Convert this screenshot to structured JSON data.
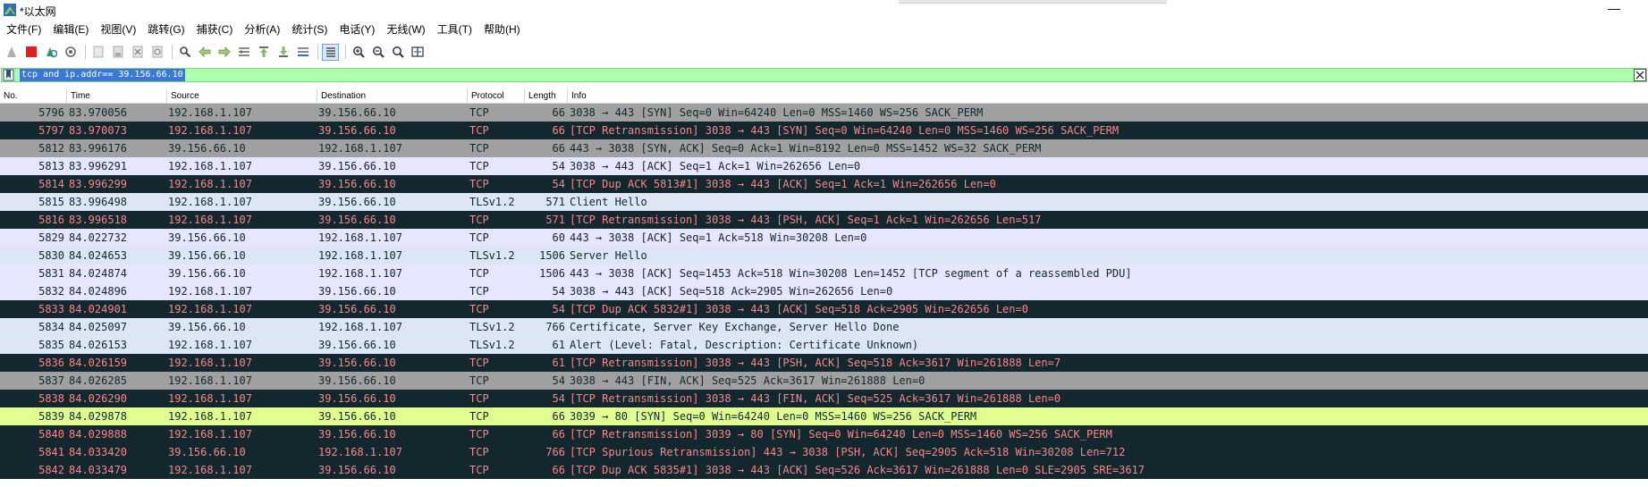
{
  "window": {
    "title": "*以太网"
  },
  "menu": [
    "文件(F)",
    "编辑(E)",
    "视图(V)",
    "跳转(G)",
    "捕获(C)",
    "分析(A)",
    "统计(S)",
    "电话(Y)",
    "无线(W)",
    "工具(T)",
    "帮助(H)"
  ],
  "filter": {
    "value": "tcp and ip.addr== 39.156.66.10"
  },
  "columns": [
    "No.",
    "Time",
    "Source",
    "Destination",
    "Protocol",
    "Length",
    "Info"
  ],
  "colors": {
    "syn_bg": "#a0a0a0",
    "bad_bg": "#12272e",
    "bad_fg": "#f78787",
    "tcp_bg": "#e7e6ff",
    "ssl_bg": "#dde6f5",
    "filter_bg": "#afffaf",
    "selected_bg": "#e0ff90"
  },
  "packets": [
    {
      "no": "5796",
      "time": "83.970056",
      "src": "192.168.1.107",
      "dst": "39.156.66.10",
      "proto": "TCP",
      "len": "66",
      "info": "3038 → 443 [SYN] Seq=0 Win=64240 Len=0 MSS=1460 WS=256 SACK_PERM",
      "style": "syn"
    },
    {
      "no": "5797",
      "time": "83.970073",
      "src": "192.168.1.107",
      "dst": "39.156.66.10",
      "proto": "TCP",
      "len": "66",
      "info": "[TCP Retransmission] 3038 → 443 [SYN] Seq=0 Win=64240 Len=0 MSS=1460 WS=256 SACK_PERM",
      "style": "bad"
    },
    {
      "no": "5812",
      "time": "83.996176",
      "src": "39.156.66.10",
      "dst": "192.168.1.107",
      "proto": "TCP",
      "len": "66",
      "info": "443 → 3038 [SYN, ACK] Seq=0 Ack=1 Win=8192 Len=0 MSS=1452 WS=32 SACK_PERM",
      "style": "syn"
    },
    {
      "no": "5813",
      "time": "83.996291",
      "src": "192.168.1.107",
      "dst": "39.156.66.10",
      "proto": "TCP",
      "len": "54",
      "info": "3038 → 443 [ACK] Seq=1 Ack=1 Win=262656 Len=0",
      "style": "tcp"
    },
    {
      "no": "5814",
      "time": "83.996299",
      "src": "192.168.1.107",
      "dst": "39.156.66.10",
      "proto": "TCP",
      "len": "54",
      "info": "[TCP Dup ACK 5813#1] 3038 → 443 [ACK] Seq=1 Ack=1 Win=262656 Len=0",
      "style": "bad"
    },
    {
      "no": "5815",
      "time": "83.996498",
      "src": "192.168.1.107",
      "dst": "39.156.66.10",
      "proto": "TLSv1.2",
      "len": "571",
      "info": "Client Hello",
      "style": "ssl"
    },
    {
      "no": "5816",
      "time": "83.996518",
      "src": "192.168.1.107",
      "dst": "39.156.66.10",
      "proto": "TCP",
      "len": "571",
      "info": "[TCP Retransmission] 3038 → 443 [PSH, ACK] Seq=1 Ack=1 Win=262656 Len=517",
      "style": "bad"
    },
    {
      "no": "5829",
      "time": "84.022732",
      "src": "39.156.66.10",
      "dst": "192.168.1.107",
      "proto": "TCP",
      "len": "60",
      "info": "443 → 3038 [ACK] Seq=1 Ack=518 Win=30208 Len=0",
      "style": "tcp"
    },
    {
      "no": "5830",
      "time": "84.024653",
      "src": "39.156.66.10",
      "dst": "192.168.1.107",
      "proto": "TLSv1.2",
      "len": "1506",
      "info": "Server Hello",
      "style": "ssl"
    },
    {
      "no": "5831",
      "time": "84.024874",
      "src": "39.156.66.10",
      "dst": "192.168.1.107",
      "proto": "TCP",
      "len": "1506",
      "info": "443 → 3038 [ACK] Seq=1453 Ack=518 Win=30208 Len=1452 [TCP segment of a reassembled PDU]",
      "style": "tcp"
    },
    {
      "no": "5832",
      "time": "84.024896",
      "src": "192.168.1.107",
      "dst": "39.156.66.10",
      "proto": "TCP",
      "len": "54",
      "info": "3038 → 443 [ACK] Seq=518 Ack=2905 Win=262656 Len=0",
      "style": "tcp"
    },
    {
      "no": "5833",
      "time": "84.024901",
      "src": "192.168.1.107",
      "dst": "39.156.66.10",
      "proto": "TCP",
      "len": "54",
      "info": "[TCP Dup ACK 5832#1] 3038 → 443 [ACK] Seq=518 Ack=2905 Win=262656 Len=0",
      "style": "bad"
    },
    {
      "no": "5834",
      "time": "84.025097",
      "src": "39.156.66.10",
      "dst": "192.168.1.107",
      "proto": "TLSv1.2",
      "len": "766",
      "info": "Certificate, Server Key Exchange, Server Hello Done",
      "style": "ssl"
    },
    {
      "no": "5835",
      "time": "84.026153",
      "src": "192.168.1.107",
      "dst": "39.156.66.10",
      "proto": "TLSv1.2",
      "len": "61",
      "info": "Alert (Level: Fatal, Description: Certificate Unknown)",
      "style": "ssl"
    },
    {
      "no": "5836",
      "time": "84.026159",
      "src": "192.168.1.107",
      "dst": "39.156.66.10",
      "proto": "TCP",
      "len": "61",
      "info": "[TCP Retransmission] 3038 → 443 [PSH, ACK] Seq=518 Ack=3617 Win=261888 Len=7",
      "style": "bad"
    },
    {
      "no": "5837",
      "time": "84.026285",
      "src": "192.168.1.107",
      "dst": "39.156.66.10",
      "proto": "TCP",
      "len": "54",
      "info": "3038 → 443 [FIN, ACK] Seq=525 Ack=3617 Win=261888 Len=0",
      "style": "syn"
    },
    {
      "no": "5838",
      "time": "84.026290",
      "src": "192.168.1.107",
      "dst": "39.156.66.10",
      "proto": "TCP",
      "len": "54",
      "info": "[TCP Retransmission] 3038 → 443 [FIN, ACK] Seq=525 Ack=3617 Win=261888 Len=0",
      "style": "bad"
    },
    {
      "no": "5839",
      "time": "84.029878",
      "src": "192.168.1.107",
      "dst": "39.156.66.10",
      "proto": "TCP",
      "len": "66",
      "info": "3039 → 80 [SYN] Seq=0 Win=64240 Len=0 MSS=1460 WS=256 SACK_PERM",
      "style": "connsel"
    },
    {
      "no": "5840",
      "time": "84.029888",
      "src": "192.168.1.107",
      "dst": "39.156.66.10",
      "proto": "TCP",
      "len": "66",
      "info": "[TCP Retransmission] 3039 → 80 [SYN] Seq=0 Win=64240 Len=0 MSS=1460 WS=256 SACK_PERM",
      "style": "bad"
    },
    {
      "no": "5841",
      "time": "84.033420",
      "src": "39.156.66.10",
      "dst": "192.168.1.107",
      "proto": "TCP",
      "len": "766",
      "info": "[TCP Spurious Retransmission] 443 → 3038 [PSH, ACK] Seq=2905 Ack=518 Win=30208 Len=712",
      "style": "bad"
    },
    {
      "no": "5842",
      "time": "84.033479",
      "src": "192.168.1.107",
      "dst": "39.156.66.10",
      "proto": "TCP",
      "len": "66",
      "info": "[TCP Dup ACK 5835#1] 3038 → 443 [ACK] Seq=526 Ack=3617 Win=261888 Len=0 SLE=2905 SRE=3617",
      "style": "bad"
    }
  ]
}
